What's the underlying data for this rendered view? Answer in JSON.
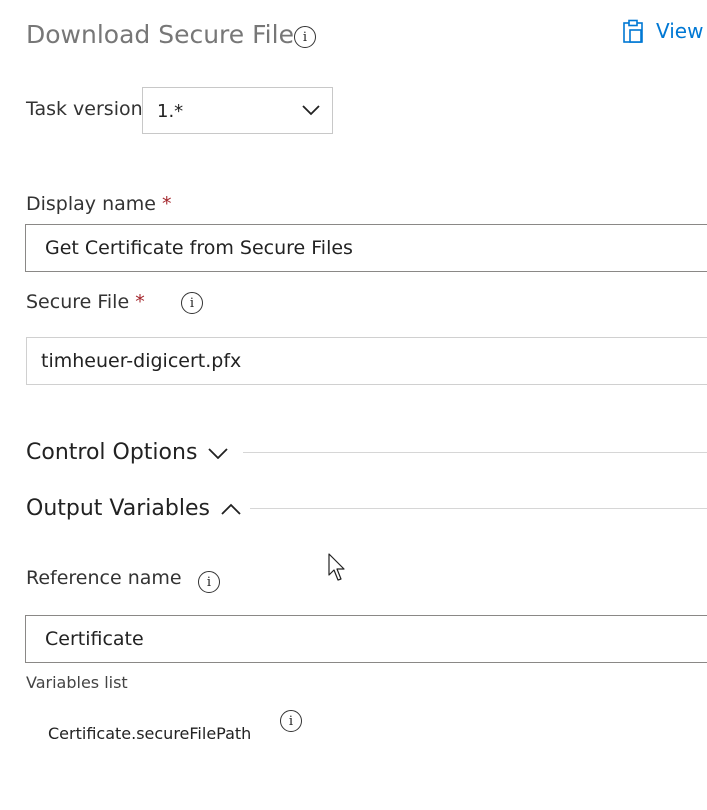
{
  "header": {
    "title": "Download Secure File",
    "view_link": "View"
  },
  "task_version": {
    "label": "Task version",
    "selected": "1.*"
  },
  "display_name": {
    "label": "Display name",
    "required_marker": "*",
    "value": "Get Certificate from Secure Files"
  },
  "secure_file": {
    "label": "Secure File",
    "required_marker": "*",
    "value": "timheuer-digicert.pfx"
  },
  "control_options": {
    "label": "Control Options"
  },
  "output_variables": {
    "label": "Output Variables",
    "reference_name_label": "Reference name",
    "reference_name_value": "Certificate",
    "variables_list_label": "Variables list",
    "variables": [
      "Certificate.secureFilePath"
    ]
  },
  "icons": {
    "info": "info-icon",
    "view": "clipboard-icon",
    "chevron_down": "chevron-down-icon",
    "chevron_up": "chevron-up-icon",
    "cursor": "mouse-cursor-icon"
  },
  "colors": {
    "accent": "#0078d4",
    "required": "#a4262c",
    "title": "#777777"
  }
}
